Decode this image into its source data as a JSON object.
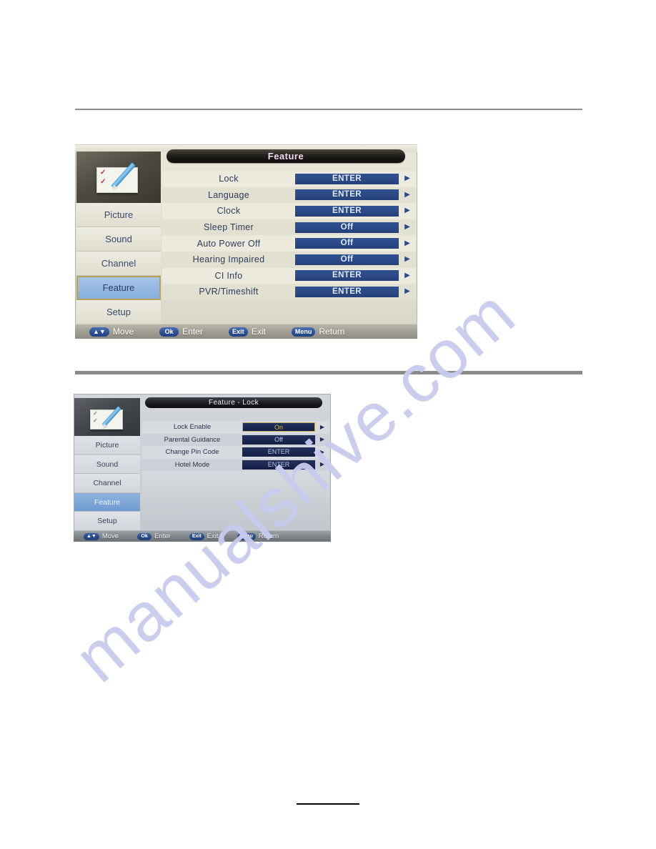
{
  "page": {
    "background_color": "#ffffff",
    "watermark_text": "manualshive.com",
    "watermark_color": "#c9cbee"
  },
  "screenshot_feature": {
    "title": "Feature",
    "sidebar": {
      "icon_name": "notepad-pencil-icon",
      "items": [
        {
          "label": "Picture",
          "selected": false
        },
        {
          "label": "Sound",
          "selected": false
        },
        {
          "label": "Channel",
          "selected": false
        },
        {
          "label": "Feature",
          "selected": true
        },
        {
          "label": "Setup",
          "selected": false
        }
      ]
    },
    "rows": [
      {
        "label": "Lock",
        "value": "ENTER",
        "selected": false
      },
      {
        "label": "Language",
        "value": "ENTER",
        "selected": false
      },
      {
        "label": "Clock",
        "value": "ENTER",
        "selected": false
      },
      {
        "label": "Sleep Timer",
        "value": "Off",
        "selected": false
      },
      {
        "label": "Auto Power Off",
        "value": "Off",
        "selected": false
      },
      {
        "label": "Hearing Impaired",
        "value": "Off",
        "selected": false
      },
      {
        "label": "CI Info",
        "value": "ENTER",
        "selected": false
      },
      {
        "label": "PVR/Timeshift",
        "value": "ENTER",
        "selected": false
      }
    ],
    "hints": [
      {
        "key": "▲▼",
        "label": "Move"
      },
      {
        "key": "Ok",
        "label": "Enter"
      },
      {
        "key": "Exit",
        "label": "Exit"
      },
      {
        "key": "Menu",
        "label": "Return"
      }
    ]
  },
  "screenshot_lock": {
    "title": "Feature - Lock",
    "sidebar": {
      "icon_name": "notepad-pencil-icon",
      "items": [
        {
          "label": "Picture",
          "selected": false
        },
        {
          "label": "Sound",
          "selected": false
        },
        {
          "label": "Channel",
          "selected": false
        },
        {
          "label": "Feature",
          "selected": true
        },
        {
          "label": "Setup",
          "selected": false
        }
      ]
    },
    "rows": [
      {
        "label": "Lock Enable",
        "value": "On",
        "selected": true
      },
      {
        "label": "Parental Guidance",
        "value": "Off",
        "selected": false
      },
      {
        "label": "Change Pin Code",
        "value": "ENTER",
        "selected": false
      },
      {
        "label": "Hotel Mode",
        "value": "ENTER",
        "selected": false
      }
    ],
    "hints": [
      {
        "key": "▲▼",
        "label": "Move"
      },
      {
        "key": "Ok",
        "label": "Enter"
      },
      {
        "key": "Exit",
        "label": "Exit"
      },
      {
        "key": "Menu",
        "label": "Return"
      }
    ]
  }
}
